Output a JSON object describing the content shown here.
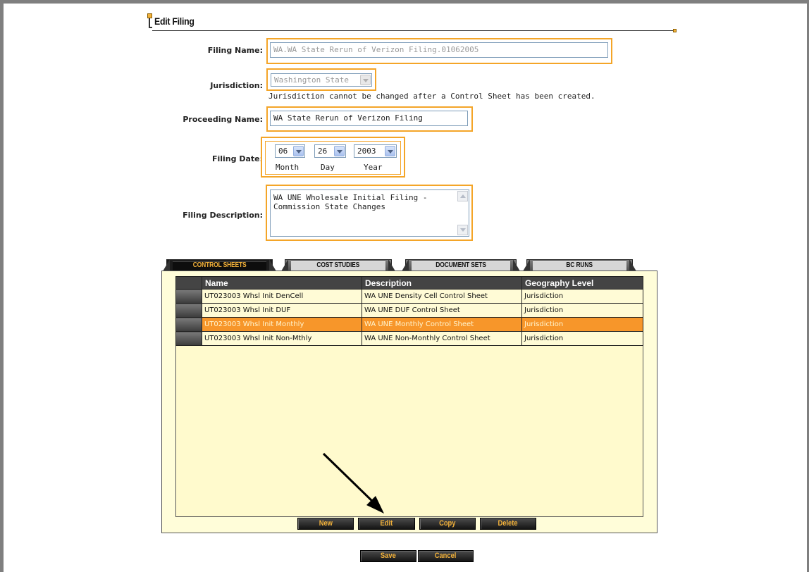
{
  "section": {
    "title": "Edit Filing"
  },
  "form": {
    "filing_name": {
      "label": "Filing Name:",
      "value": "WA.WA State Rerun of Verizon Filing.01062005"
    },
    "jurisdiction": {
      "label": "Jurisdiction:",
      "value": "Washington State",
      "note": "Jurisdiction cannot be changed after a Control Sheet has been created."
    },
    "proceeding_name": {
      "label": "Proceeding Name:",
      "value": "WA State Rerun of Verizon Filing"
    },
    "filing_date": {
      "label": "Filing Date:",
      "month": "06",
      "day": "26",
      "year": "2003",
      "month_label": "Month",
      "day_label": "Day",
      "year_label": "Year"
    },
    "filing_description": {
      "label": "Filing Description:",
      "line1": "WA UNE Wholesale Initial Filing -",
      "line2": "Commission State Changes"
    }
  },
  "tabs": [
    {
      "label": "CONTROL SHEETS",
      "active": true
    },
    {
      "label": "COST STUDIES",
      "active": false
    },
    {
      "label": "DOCUMENT SETS",
      "active": false
    },
    {
      "label": "BC RUNS",
      "active": false
    }
  ],
  "table": {
    "headers": [
      "Name",
      "Description",
      "Geography Level"
    ],
    "rows": [
      {
        "name": "UT023003 Whsl Init DenCell",
        "description": "WA UNE Density Cell Control Sheet",
        "geo": "Jurisdiction",
        "selected": false
      },
      {
        "name": "UT023003 Whsl Init DUF",
        "description": "WA UNE DUF Control Sheet",
        "geo": "Jurisdiction",
        "selected": false
      },
      {
        "name": "UT023003 Whsl Init Monthly",
        "description": "WA UNE Monthly Control Sheet",
        "geo": "Jurisdiction",
        "selected": true
      },
      {
        "name": "UT023003 Whsl Init Non-Mthly",
        "description": "WA UNE Non-Monthly Control Sheet",
        "geo": "Jurisdiction",
        "selected": false
      }
    ]
  },
  "table_actions": {
    "new": "New",
    "edit": "Edit",
    "copy": "Copy",
    "delete": "Delete"
  },
  "form_actions": {
    "save": "Save",
    "cancel": "Cancel"
  },
  "colors": {
    "accent_orange": "#f4a528",
    "selected_row": "#f7962a",
    "panel_bg": "#fffacd",
    "button_text": "#f2b13a"
  }
}
